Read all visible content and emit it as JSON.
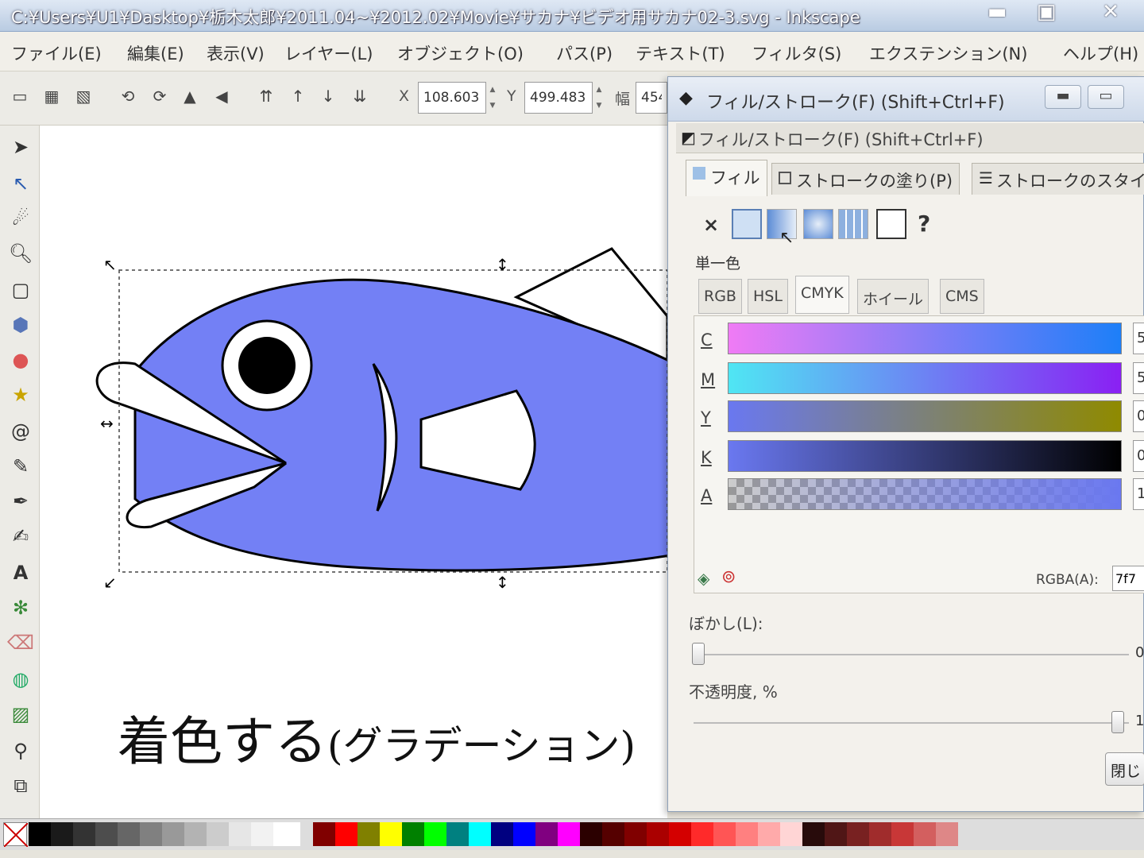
{
  "window": {
    "title": "C:¥Users¥U1¥Dasktop¥栃木太郎¥2011.04~¥2012.02¥Movie¥サカナ¥ビデオ用サカナ02-3.svg - Inkscape",
    "minimize": "▬",
    "maximize": "▣",
    "close": "✕"
  },
  "menu": [
    "ファイル(E)",
    "編集(E)",
    "表示(V)",
    "レイヤー(L)",
    "オブジェクト(O)",
    "パス(P)",
    "テキスト(T)",
    "フィルタ(S)",
    "エクステンション(N)",
    "ヘルプ(H)"
  ],
  "toolctrl": {
    "x_label": "X",
    "x_value": "108.603",
    "y_label": "Y",
    "y_value": "499.483",
    "w_label": "幅",
    "w_value": "454"
  },
  "canvas": {
    "caption_main": "着色する",
    "caption_sub": "(グラデーション)",
    "fish_color": "#7380f5"
  },
  "dialog": {
    "title": "フィル/ストローク(F) (Shift+Ctrl+F)",
    "panel_title": "フィル/ストローク(F) (Shift+Ctrl+F)",
    "tabs": [
      "フィル",
      "ストロークの塗り(P)",
      "ストロークのスタイル"
    ],
    "paint_none": "×",
    "paint_unknown": "?",
    "flat_color_label": "単一色",
    "color_tabs": [
      "RGB",
      "HSL",
      "CMYK",
      "ホイール",
      "CMS"
    ],
    "channels": [
      {
        "label": "C",
        "value": "5"
      },
      {
        "label": "M",
        "value": "5"
      },
      {
        "label": "Y",
        "value": "0"
      },
      {
        "label": "K",
        "value": "0"
      },
      {
        "label": "A",
        "value": "1"
      }
    ],
    "rgba_label": "RGBA(A):",
    "rgba_value": "7f7",
    "blur_label": "ぼかし(L):",
    "blur_value": "0",
    "opacity_label": "不透明度, %",
    "opacity_value": "1",
    "close_button": "閉じ"
  }
}
